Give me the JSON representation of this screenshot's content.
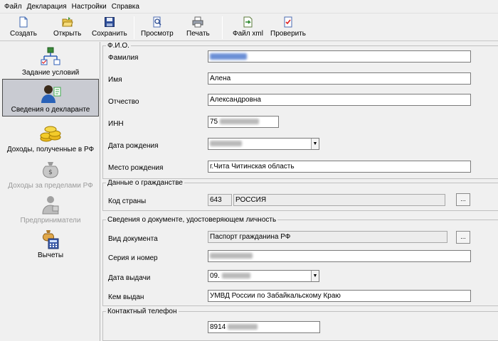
{
  "menu": [
    "Файл",
    "Декларация",
    "Настройки",
    "Справка"
  ],
  "toolbar": {
    "create": "Создать",
    "open": "Открыть",
    "save": "Сохранить",
    "preview": "Просмотр",
    "print": "Печать",
    "xml": "Файл xml",
    "check": "Проверить"
  },
  "nav": {
    "conditions": "Задание условий",
    "declarant": "Сведения о декларанте",
    "income_rf": "Доходы, полученные в РФ",
    "income_abroad": "Доходы за пределами РФ",
    "entrepreneurs": "Предприниматели",
    "deductions": "Вычеты"
  },
  "fio": {
    "legend": "Ф.И.О.",
    "surname_label": "Фамилия",
    "name_label": "Имя",
    "name_value": "Алена",
    "patronymic_label": "Отчество",
    "patronymic_value": "Александровна",
    "inn_label": "ИНН",
    "inn_value": "75",
    "birthdate_label": "Дата рождения",
    "birthplace_label": "Место рождения",
    "birthplace_value": "г.Чита Читинская область"
  },
  "citizenship": {
    "legend": "Данные о гражданстве",
    "country_label": "Код страны",
    "country_code": "643",
    "country_name": "РОССИЯ",
    "browse": "..."
  },
  "document": {
    "legend": "Сведения о документе, удостоверяющем личность",
    "type_label": "Вид документа",
    "type_value": "Паспорт гражданина РФ",
    "browse": "...",
    "series_label": "Серия и номер",
    "issue_date_label": "Дата выдачи",
    "issue_date_value": "09.",
    "issued_by_label": "Кем выдан",
    "issued_by_value": "УМВД России по Забайкальскому Краю"
  },
  "contact": {
    "legend": "Контактный телефон",
    "phone_value": "8914"
  },
  "colors": {
    "background": "#f0f0f0",
    "active_nav": "#c9cbd2",
    "input_bg": "#ffffff",
    "readonly_bg": "#ececec"
  }
}
